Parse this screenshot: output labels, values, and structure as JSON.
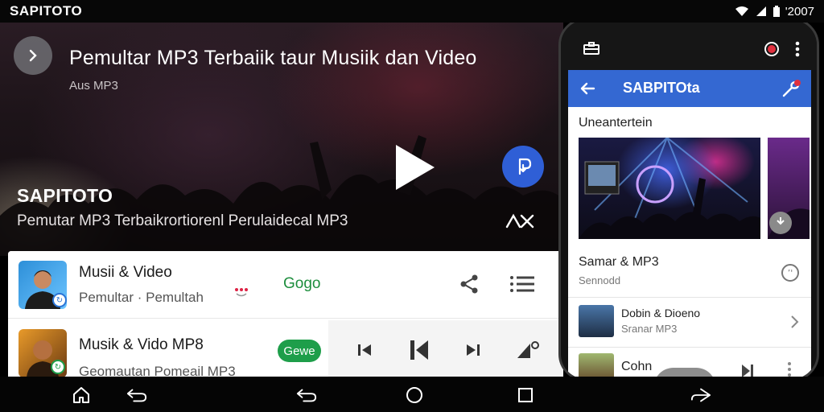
{
  "status_bar": {
    "title": "SAPITOTO",
    "time": "'2007"
  },
  "hero": {
    "back_icon": "chevron-right-icon",
    "title": "Pemultar MP3 Terbaiik taur Musiik dan Video",
    "subtitle": "Aus MP3",
    "name": "SAPITOTO",
    "description": "Pemutar MP3 Terbaikrortiorenl Perulaidecal  MP3",
    "play_icon": "play-icon",
    "action_icon": "download-icon",
    "shuffle_icon": "shuffle-icon",
    "accent": "#2f5fd6"
  },
  "list": {
    "items": [
      {
        "title": "Musii & Video",
        "subtitle": "Pemultar · Pemultah",
        "tag": "Gogo",
        "share_icon": "share-icon",
        "menu_icon": "list-icon"
      },
      {
        "title": "Musik & Vido MP8",
        "subtitle": "Geomautan Pomeail  MP3",
        "pill": "Gewe",
        "controls": [
          "skip-back-icon",
          "previous-icon",
          "next-icon",
          "volume-icon"
        ]
      }
    ],
    "green": "#1e9e4a"
  },
  "phone": {
    "top_icons": [
      "briefcase-icon",
      "record-icon",
      "more-vert-icon"
    ],
    "app_bar": {
      "title": "SABPITOta",
      "back_icon": "arrow-left-icon",
      "tool_icon": "wrench-icon",
      "color": "#3468d2"
    },
    "section_title": "Uneantertein",
    "cards": [
      {
        "name": "concert-card"
      },
      {
        "name": "second-card"
      }
    ],
    "rows": [
      {
        "title": "Samar & MP3",
        "subtitle": "Sennodd"
      },
      {
        "title": "Dobin & Dioeno",
        "subtitle": "Sranar MP3"
      },
      {
        "title": "Cohn",
        "subtitle": ""
      }
    ]
  },
  "nav_bar": {
    "icons": [
      "home-icon",
      "back-icon",
      "back-icon",
      "circle-home-icon",
      "recents-icon",
      "rotate-icon"
    ]
  }
}
